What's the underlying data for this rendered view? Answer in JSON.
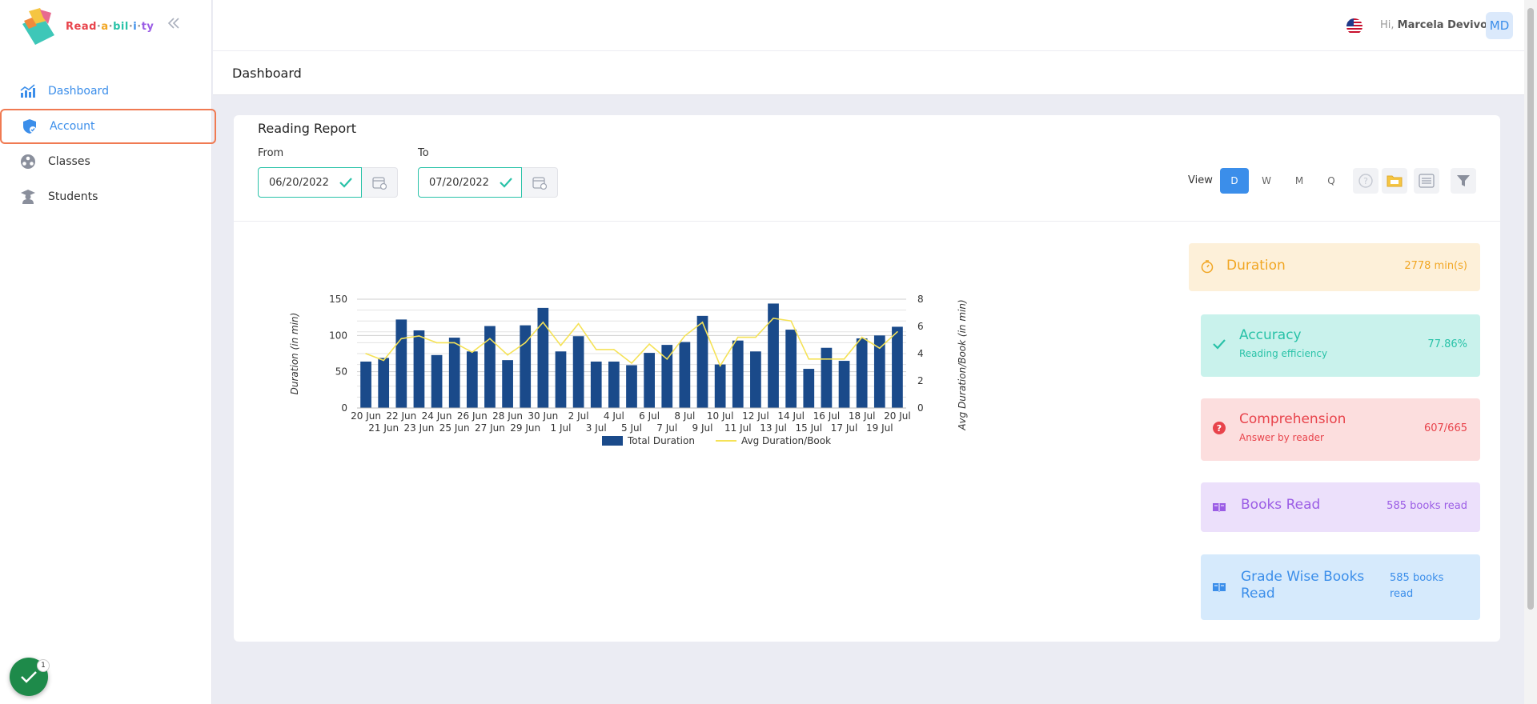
{
  "app": {
    "logo_text": "Read-a-bil-i-ty"
  },
  "sidebar": {
    "items": [
      {
        "label": "Dashboard",
        "icon": "chart-line-icon"
      },
      {
        "label": "Account",
        "icon": "shield-user-icon"
      },
      {
        "label": "Classes",
        "icon": "people-circle-icon"
      },
      {
        "label": "Students",
        "icon": "graduate-icon"
      }
    ],
    "notification_count": "1"
  },
  "topbar": {
    "greeting_prefix": "Hi,",
    "user_name": "Marcela Devivo",
    "avatar_initials": "MD",
    "flag": "us-flag-icon"
  },
  "page": {
    "title": "Dashboard"
  },
  "report": {
    "title": "Reading Report",
    "from_label": "From",
    "from_value": "06/20/2022",
    "to_label": "To",
    "to_value": "07/20/2022",
    "view_label": "View",
    "view_options": [
      "D",
      "W",
      "M",
      "Q"
    ],
    "view_selected": "D"
  },
  "stats": {
    "duration": {
      "title": "Duration",
      "value": "2778 min(s)",
      "color": "#f1a623"
    },
    "accuracy": {
      "title": "Accuracy",
      "subtitle": "Reading efficiency",
      "value": "77.86%",
      "color": "#29c2a8"
    },
    "comprehension": {
      "title": "Comprehension",
      "subtitle": "Answer by reader",
      "value": "607/665",
      "color": "#e8434b"
    },
    "books_read": {
      "title": "Books Read",
      "value": "585 books read",
      "color": "#9b5de5"
    },
    "grade_books": {
      "title": "Grade Wise Books Read",
      "value": "585 books read",
      "color": "#3b8eea"
    }
  },
  "chart_data": {
    "type": "bar",
    "categories": [
      "20 Jun",
      "21 Jun",
      "22 Jun",
      "23 Jun",
      "24 Jun",
      "25 Jun",
      "26 Jun",
      "27 Jun",
      "28 Jun",
      "29 Jun",
      "30 Jun",
      "1 Jul",
      "2 Jul",
      "3 Jul",
      "4 Jul",
      "5 Jul",
      "6 Jul",
      "7 Jul",
      "8 Jul",
      "9 Jul",
      "10 Jul",
      "11 Jul",
      "12 Jul",
      "13 Jul",
      "14 Jul",
      "15 Jul",
      "16 Jul",
      "17 Jul",
      "18 Jul",
      "19 Jul",
      "20 Jul"
    ],
    "series": [
      {
        "name": "Total Duration",
        "axis": "left",
        "type": "bar",
        "color": "#1a4a8a",
        "values": [
          64,
          69,
          122,
          107,
          73,
          97,
          78,
          113,
          66,
          114,
          138,
          78,
          99,
          64,
          64,
          59,
          76,
          87,
          91,
          127,
          60,
          93,
          78,
          144,
          108,
          54,
          83,
          65,
          96,
          100,
          112
        ]
      },
      {
        "name": "Avg Duration/Book",
        "axis": "right",
        "type": "line",
        "color": "#f5e257",
        "values": [
          4.0,
          3.5,
          5.1,
          5.3,
          4.8,
          4.8,
          4.1,
          5.1,
          3.9,
          4.8,
          6.3,
          4.6,
          6.2,
          4.3,
          4.3,
          3.3,
          4.7,
          3.6,
          5.3,
          6.3,
          3.1,
          5.2,
          5.2,
          6.6,
          6.4,
          3.6,
          3.6,
          3.6,
          5.2,
          4.4,
          5.6
        ]
      }
    ],
    "ylabel": "Duration (in min)",
    "y2label": "Avg Duration/Book (in min)",
    "ylim": [
      0,
      150
    ],
    "y2lim": [
      0,
      8
    ],
    "yticks": [
      0,
      50,
      100,
      150
    ],
    "y2ticks": [
      0,
      2,
      4,
      6,
      8
    ],
    "grid": true,
    "legend": "bottom"
  }
}
